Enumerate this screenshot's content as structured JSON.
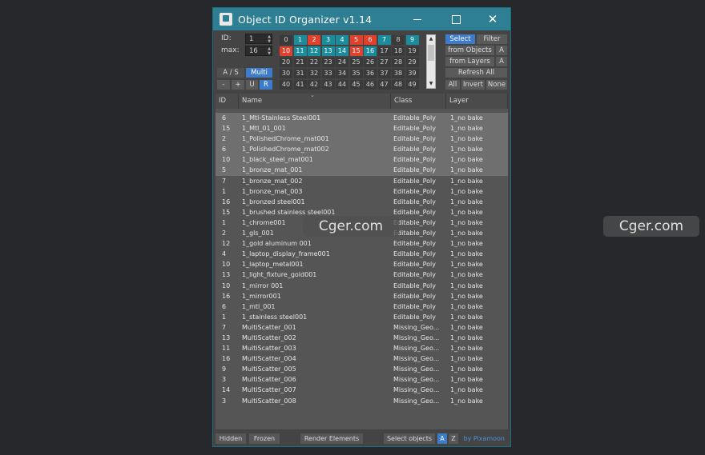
{
  "window": {
    "title": "Object ID Organizer  v1.14"
  },
  "controls": {
    "id_label": "ID:",
    "id_value": "1",
    "max_label": "max:",
    "max_value": "16",
    "as_label": "A / S",
    "multi_label": "Multi",
    "minus_label": "-",
    "plus_label": "+",
    "u_label": "U",
    "r_label": "R"
  },
  "grid": [
    [
      {
        "n": "0",
        "c": "#3a3a3a"
      },
      {
        "n": "1",
        "c": "#1a8c9c"
      },
      {
        "n": "2",
        "c": "#e0402c"
      },
      {
        "n": "3",
        "c": "#1a8c9c"
      },
      {
        "n": "4",
        "c": "#1a8c9c"
      },
      {
        "n": "5",
        "c": "#e0402c"
      },
      {
        "n": "6",
        "c": "#e0402c"
      },
      {
        "n": "7",
        "c": "#1a8c9c"
      },
      {
        "n": "8",
        "c": "#3a3a3a"
      },
      {
        "n": "9",
        "c": "#1a8c9c"
      }
    ],
    [
      {
        "n": "10",
        "c": "#e0402c"
      },
      {
        "n": "11",
        "c": "#1a8c9c"
      },
      {
        "n": "12",
        "c": "#1a8c9c"
      },
      {
        "n": "13",
        "c": "#1a8c9c"
      },
      {
        "n": "14",
        "c": "#1a8c9c"
      },
      {
        "n": "15",
        "c": "#e0402c"
      },
      {
        "n": "16",
        "c": "#1a8c9c"
      },
      {
        "n": "17",
        "c": "#3a3a3a"
      },
      {
        "n": "18",
        "c": "#3a3a3a"
      },
      {
        "n": "19",
        "c": "#3a3a3a"
      }
    ],
    [
      {
        "n": "20",
        "c": "#3a3a3a"
      },
      {
        "n": "21",
        "c": "#3a3a3a"
      },
      {
        "n": "22",
        "c": "#3a3a3a"
      },
      {
        "n": "23",
        "c": "#3a3a3a"
      },
      {
        "n": "24",
        "c": "#3a3a3a"
      },
      {
        "n": "25",
        "c": "#3a3a3a"
      },
      {
        "n": "26",
        "c": "#3a3a3a"
      },
      {
        "n": "27",
        "c": "#3a3a3a"
      },
      {
        "n": "28",
        "c": "#3a3a3a"
      },
      {
        "n": "29",
        "c": "#3a3a3a"
      }
    ],
    [
      {
        "n": "30",
        "c": "#3a3a3a"
      },
      {
        "n": "31",
        "c": "#3a3a3a"
      },
      {
        "n": "32",
        "c": "#3a3a3a"
      },
      {
        "n": "33",
        "c": "#3a3a3a"
      },
      {
        "n": "34",
        "c": "#3a3a3a"
      },
      {
        "n": "35",
        "c": "#3a3a3a"
      },
      {
        "n": "36",
        "c": "#3a3a3a"
      },
      {
        "n": "37",
        "c": "#3a3a3a"
      },
      {
        "n": "38",
        "c": "#3a3a3a"
      },
      {
        "n": "39",
        "c": "#3a3a3a"
      }
    ],
    [
      {
        "n": "40",
        "c": "#3a3a3a"
      },
      {
        "n": "41",
        "c": "#3a3a3a"
      },
      {
        "n": "42",
        "c": "#3a3a3a"
      },
      {
        "n": "43",
        "c": "#3a3a3a"
      },
      {
        "n": "44",
        "c": "#3a3a3a"
      },
      {
        "n": "45",
        "c": "#3a3a3a"
      },
      {
        "n": "46",
        "c": "#3a3a3a"
      },
      {
        "n": "47",
        "c": "#3a3a3a"
      },
      {
        "n": "48",
        "c": "#3a3a3a"
      },
      {
        "n": "49",
        "c": "#3a3a3a"
      }
    ]
  ],
  "right_buttons": {
    "select": "Select",
    "filter": "Filter",
    "from_objects": "from Objects",
    "from_objects_a": "A",
    "from_layers": "from Layers",
    "from_layers_a": "A",
    "refresh_all": "Refresh All",
    "all": "All",
    "invert": "Invert",
    "none": "None"
  },
  "table": {
    "columns": [
      "ID",
      "Name",
      "Class",
      "Layer"
    ],
    "rows": [
      {
        "id": "6",
        "name": "1_Mtl-Stainless Steel001",
        "cls": "Editable_Poly",
        "layer": "1_no bake",
        "sel": true
      },
      {
        "id": "15",
        "name": "1_Mtl_01_001",
        "cls": "Editable_Poly",
        "layer": "1_no bake",
        "sel": true
      },
      {
        "id": "2",
        "name": "1_PolishedChrome_mat001",
        "cls": "Editable_Poly",
        "layer": "1_no bake",
        "sel": true
      },
      {
        "id": "6",
        "name": "1_PolishedChrome_mat002",
        "cls": "Editable_Poly",
        "layer": "1_no bake",
        "sel": true
      },
      {
        "id": "10",
        "name": "1_black_steel_mat001",
        "cls": "Editable_Poly",
        "layer": "1_no bake",
        "sel": true
      },
      {
        "id": "5",
        "name": "1_bronze_mat_001",
        "cls": "Editable_Poly",
        "layer": "1_no bake",
        "sel": true
      },
      {
        "id": "7",
        "name": "1_bronze_mat_002",
        "cls": "Editable_Poly",
        "layer": "1_no bake",
        "sel": false
      },
      {
        "id": "1",
        "name": "1_bronze_mat_003",
        "cls": "Editable_Poly",
        "layer": "1_no bake",
        "sel": false
      },
      {
        "id": "16",
        "name": "1_bronzed steel001",
        "cls": "Editable_Poly",
        "layer": "1_no bake",
        "sel": false
      },
      {
        "id": "15",
        "name": "1_brushed stainless steel001",
        "cls": "Editable_Poly",
        "layer": "1_no bake",
        "sel": false
      },
      {
        "id": "1",
        "name": "1_chrome001",
        "cls": "Editable_Poly",
        "layer": "1_no bake",
        "sel": false
      },
      {
        "id": "2",
        "name": "1_gls_001",
        "cls": "Editable_Poly",
        "layer": "1_no bake",
        "sel": false
      },
      {
        "id": "12",
        "name": "1_gold aluminum 001",
        "cls": "Editable_Poly",
        "layer": "1_no bake",
        "sel": false
      },
      {
        "id": "4",
        "name": "1_laptop_display_frame001",
        "cls": "Editable_Poly",
        "layer": "1_no bake",
        "sel": false
      },
      {
        "id": "10",
        "name": "1_laptop_metal001",
        "cls": "Editable_Poly",
        "layer": "1_no bake",
        "sel": false
      },
      {
        "id": "13",
        "name": "1_light_fixture_gold001",
        "cls": "Editable_Poly",
        "layer": "1_no bake",
        "sel": false
      },
      {
        "id": "10",
        "name": "1_mirror 001",
        "cls": "Editable_Poly",
        "layer": "1_no bake",
        "sel": false
      },
      {
        "id": "16",
        "name": "1_mirror001",
        "cls": "Editable_Poly",
        "layer": "1_no bake",
        "sel": false
      },
      {
        "id": "6",
        "name": "1_mtl_001",
        "cls": "Editable_Poly",
        "layer": "1_no bake",
        "sel": false
      },
      {
        "id": "1",
        "name": "1_stainless steel001",
        "cls": "Editable_Poly",
        "layer": "1_no bake",
        "sel": false
      },
      {
        "id": "7",
        "name": "MultiScatter_001",
        "cls": "Missing_Geo...",
        "layer": "1_no bake",
        "sel": false
      },
      {
        "id": "13",
        "name": "MultiScatter_002",
        "cls": "Missing_Geo...",
        "layer": "1_no bake",
        "sel": false
      },
      {
        "id": "11",
        "name": "MultiScatter_003",
        "cls": "Missing_Geo...",
        "layer": "1_no bake",
        "sel": false
      },
      {
        "id": "16",
        "name": "MultiScatter_004",
        "cls": "Missing_Geo...",
        "layer": "1_no bake",
        "sel": false
      },
      {
        "id": "9",
        "name": "MultiScatter_005",
        "cls": "Missing_Geo...",
        "layer": "1_no bake",
        "sel": false
      },
      {
        "id": "3",
        "name": "MultiScatter_006",
        "cls": "Missing_Geo...",
        "layer": "1_no bake",
        "sel": false
      },
      {
        "id": "14",
        "name": "MultiScatter_007",
        "cls": "Missing_Geo...",
        "layer": "1_no bake",
        "sel": false
      },
      {
        "id": "3",
        "name": "MultiScatter_008",
        "cls": "Missing_Geo...",
        "layer": "1_no bake",
        "sel": false
      }
    ]
  },
  "bottom": {
    "hidden": "Hidden",
    "frozen": "Frozen",
    "render_elements": "Render Elements",
    "select_objects": "Select objects",
    "a": "A",
    "z": "Z",
    "credit": "by Pixamoon"
  },
  "watermark": "Cger.com"
}
